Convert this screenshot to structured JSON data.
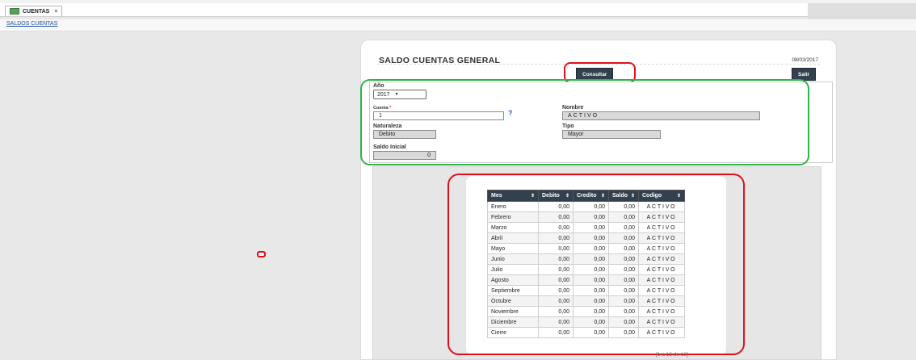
{
  "tab": {
    "label": "CUENTAS",
    "close": "×"
  },
  "breadcrumb": {
    "label": "SALDOS CUENTAS"
  },
  "page": {
    "title": "SALDO CUENTAS GENERAL",
    "date": "08/03/2017",
    "consultar_label": "Consultar",
    "salir_label": "Salir"
  },
  "form": {
    "anio_label": "Año",
    "anio_value": "2017",
    "cuenta_label": "Cuenta",
    "cuenta_required": "*",
    "cuenta_value": "1",
    "help": "?",
    "nombre_label": "Nombre",
    "nombre_value": "ACTIVO",
    "naturaleza_label": "Naturaleza",
    "naturaleza_value": "Debito",
    "tipo_label": "Tipo",
    "tipo_value": "Mayor",
    "saldo_label": "Saldo Inicial",
    "saldo_value": "0"
  },
  "table": {
    "columns": [
      "Mes",
      "Debito",
      "Credito",
      "Saldo",
      "Codigo"
    ],
    "sort_glyph": "⇕",
    "rows": [
      [
        "Enero",
        "0,00",
        "0,00",
        "0,00",
        "ACTIVO"
      ],
      [
        "Febrero",
        "0,00",
        "0,00",
        "0,00",
        "ACTIVO"
      ],
      [
        "Marzo",
        "0,00",
        "0,00",
        "0,00",
        "ACTIVO"
      ],
      [
        "Abril",
        "0,00",
        "0,00",
        "0,00",
        "ACTIVO"
      ],
      [
        "Mayo",
        "0,00",
        "0,00",
        "0,00",
        "ACTIVO"
      ],
      [
        "Junio",
        "0,00",
        "0,00",
        "0,00",
        "ACTIVO"
      ],
      [
        "Julio",
        "0,00",
        "0,00",
        "0,00",
        "ACTIVO"
      ],
      [
        "Agosto",
        "0,00",
        "0,00",
        "0,00",
        "ACTIVO"
      ],
      [
        "Septiembre",
        "0,00",
        "0,00",
        "0,00",
        "ACTIVO"
      ],
      [
        "Octubre",
        "0,00",
        "0,00",
        "0,00",
        "ACTIVO"
      ],
      [
        "Noviembre",
        "0,00",
        "0,00",
        "0,00",
        "ACTIVO"
      ],
      [
        "Diciembre",
        "0,00",
        "0,00",
        "0,00",
        "ACTIVO"
      ],
      [
        "Cierre",
        "0,00",
        "0,00",
        "0,00",
        "ACTIVO"
      ]
    ],
    "pager": "[1 a 13 de 13]"
  },
  "colors": {
    "header_bg": "#33404e",
    "annotation_red": "#e0101a",
    "annotation_green": "#2fb34a",
    "link": "#1d4ea8"
  }
}
